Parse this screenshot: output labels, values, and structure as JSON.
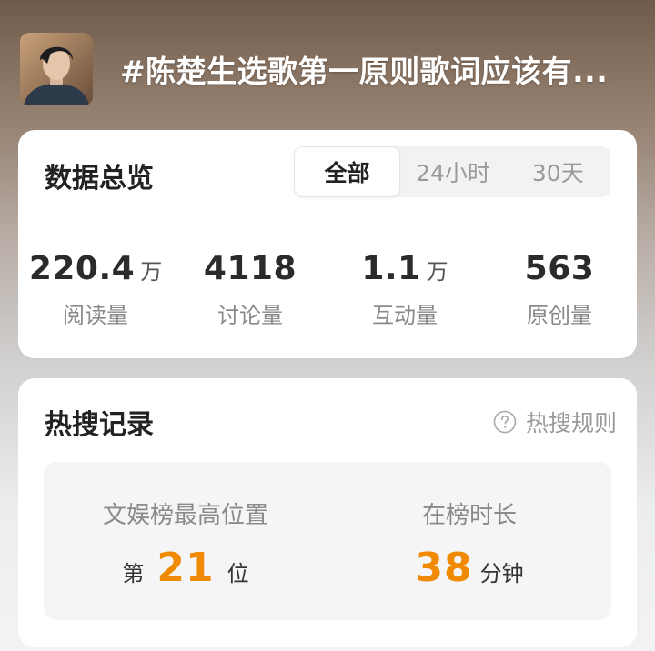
{
  "header": {
    "avatar_icon": "person-photo-icon",
    "title": "#陈楚生选歌第一原则歌词应该有..."
  },
  "overview": {
    "title": "数据总览",
    "tabs": [
      {
        "label": "全部",
        "active": true
      },
      {
        "label": "24小时",
        "active": false
      },
      {
        "label": "30天",
        "active": false
      }
    ],
    "stats": [
      {
        "value": "220.4",
        "unit": "万",
        "label": "阅读量"
      },
      {
        "value": "4118",
        "unit": "",
        "label": "讨论量"
      },
      {
        "value": "1.1",
        "unit": "万",
        "label": "互动量"
      },
      {
        "value": "563",
        "unit": "",
        "label": "原创量"
      }
    ]
  },
  "hot_search": {
    "title": "热搜记录",
    "rules_label": "热搜规则",
    "rules_icon": "question-circle-icon",
    "highest_rank": {
      "label": "文娱榜最高位置",
      "prefix": "第",
      "value": "21",
      "suffix": "位"
    },
    "duration": {
      "label": "在榜时长",
      "value": "38",
      "suffix": "分钟"
    },
    "accent_color": "#f08a00"
  }
}
